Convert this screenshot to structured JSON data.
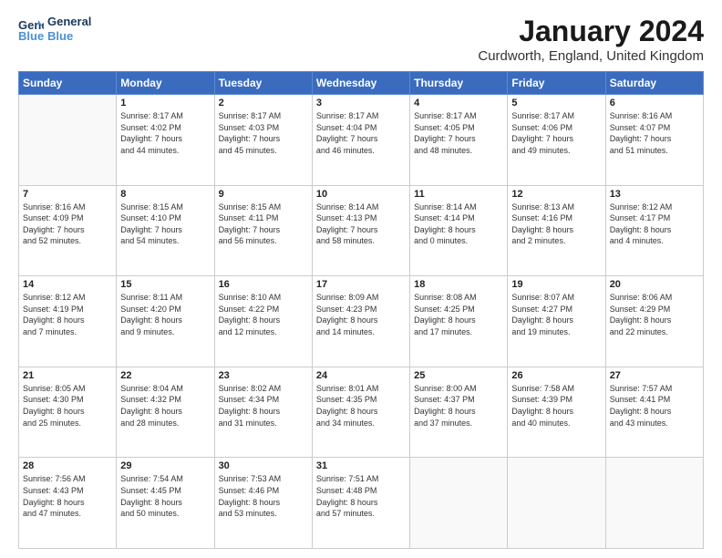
{
  "logo": {
    "line1": "General",
    "line2": "Blue"
  },
  "header": {
    "title": "January 2024",
    "location": "Curdworth, England, United Kingdom"
  },
  "days_of_week": [
    "Sunday",
    "Monday",
    "Tuesday",
    "Wednesday",
    "Thursday",
    "Friday",
    "Saturday"
  ],
  "weeks": [
    [
      {
        "day": "",
        "info": ""
      },
      {
        "day": "1",
        "info": "Sunrise: 8:17 AM\nSunset: 4:02 PM\nDaylight: 7 hours\nand 44 minutes."
      },
      {
        "day": "2",
        "info": "Sunrise: 8:17 AM\nSunset: 4:03 PM\nDaylight: 7 hours\nand 45 minutes."
      },
      {
        "day": "3",
        "info": "Sunrise: 8:17 AM\nSunset: 4:04 PM\nDaylight: 7 hours\nand 46 minutes."
      },
      {
        "day": "4",
        "info": "Sunrise: 8:17 AM\nSunset: 4:05 PM\nDaylight: 7 hours\nand 48 minutes."
      },
      {
        "day": "5",
        "info": "Sunrise: 8:17 AM\nSunset: 4:06 PM\nDaylight: 7 hours\nand 49 minutes."
      },
      {
        "day": "6",
        "info": "Sunrise: 8:16 AM\nSunset: 4:07 PM\nDaylight: 7 hours\nand 51 minutes."
      }
    ],
    [
      {
        "day": "7",
        "info": "Sunrise: 8:16 AM\nSunset: 4:09 PM\nDaylight: 7 hours\nand 52 minutes."
      },
      {
        "day": "8",
        "info": "Sunrise: 8:15 AM\nSunset: 4:10 PM\nDaylight: 7 hours\nand 54 minutes."
      },
      {
        "day": "9",
        "info": "Sunrise: 8:15 AM\nSunset: 4:11 PM\nDaylight: 7 hours\nand 56 minutes."
      },
      {
        "day": "10",
        "info": "Sunrise: 8:14 AM\nSunset: 4:13 PM\nDaylight: 7 hours\nand 58 minutes."
      },
      {
        "day": "11",
        "info": "Sunrise: 8:14 AM\nSunset: 4:14 PM\nDaylight: 8 hours\nand 0 minutes."
      },
      {
        "day": "12",
        "info": "Sunrise: 8:13 AM\nSunset: 4:16 PM\nDaylight: 8 hours\nand 2 minutes."
      },
      {
        "day": "13",
        "info": "Sunrise: 8:12 AM\nSunset: 4:17 PM\nDaylight: 8 hours\nand 4 minutes."
      }
    ],
    [
      {
        "day": "14",
        "info": "Sunrise: 8:12 AM\nSunset: 4:19 PM\nDaylight: 8 hours\nand 7 minutes."
      },
      {
        "day": "15",
        "info": "Sunrise: 8:11 AM\nSunset: 4:20 PM\nDaylight: 8 hours\nand 9 minutes."
      },
      {
        "day": "16",
        "info": "Sunrise: 8:10 AM\nSunset: 4:22 PM\nDaylight: 8 hours\nand 12 minutes."
      },
      {
        "day": "17",
        "info": "Sunrise: 8:09 AM\nSunset: 4:23 PM\nDaylight: 8 hours\nand 14 minutes."
      },
      {
        "day": "18",
        "info": "Sunrise: 8:08 AM\nSunset: 4:25 PM\nDaylight: 8 hours\nand 17 minutes."
      },
      {
        "day": "19",
        "info": "Sunrise: 8:07 AM\nSunset: 4:27 PM\nDaylight: 8 hours\nand 19 minutes."
      },
      {
        "day": "20",
        "info": "Sunrise: 8:06 AM\nSunset: 4:29 PM\nDaylight: 8 hours\nand 22 minutes."
      }
    ],
    [
      {
        "day": "21",
        "info": "Sunrise: 8:05 AM\nSunset: 4:30 PM\nDaylight: 8 hours\nand 25 minutes."
      },
      {
        "day": "22",
        "info": "Sunrise: 8:04 AM\nSunset: 4:32 PM\nDaylight: 8 hours\nand 28 minutes."
      },
      {
        "day": "23",
        "info": "Sunrise: 8:02 AM\nSunset: 4:34 PM\nDaylight: 8 hours\nand 31 minutes."
      },
      {
        "day": "24",
        "info": "Sunrise: 8:01 AM\nSunset: 4:35 PM\nDaylight: 8 hours\nand 34 minutes."
      },
      {
        "day": "25",
        "info": "Sunrise: 8:00 AM\nSunset: 4:37 PM\nDaylight: 8 hours\nand 37 minutes."
      },
      {
        "day": "26",
        "info": "Sunrise: 7:58 AM\nSunset: 4:39 PM\nDaylight: 8 hours\nand 40 minutes."
      },
      {
        "day": "27",
        "info": "Sunrise: 7:57 AM\nSunset: 4:41 PM\nDaylight: 8 hours\nand 43 minutes."
      }
    ],
    [
      {
        "day": "28",
        "info": "Sunrise: 7:56 AM\nSunset: 4:43 PM\nDaylight: 8 hours\nand 47 minutes."
      },
      {
        "day": "29",
        "info": "Sunrise: 7:54 AM\nSunset: 4:45 PM\nDaylight: 8 hours\nand 50 minutes."
      },
      {
        "day": "30",
        "info": "Sunrise: 7:53 AM\nSunset: 4:46 PM\nDaylight: 8 hours\nand 53 minutes."
      },
      {
        "day": "31",
        "info": "Sunrise: 7:51 AM\nSunset: 4:48 PM\nDaylight: 8 hours\nand 57 minutes."
      },
      {
        "day": "",
        "info": ""
      },
      {
        "day": "",
        "info": ""
      },
      {
        "day": "",
        "info": ""
      }
    ]
  ]
}
